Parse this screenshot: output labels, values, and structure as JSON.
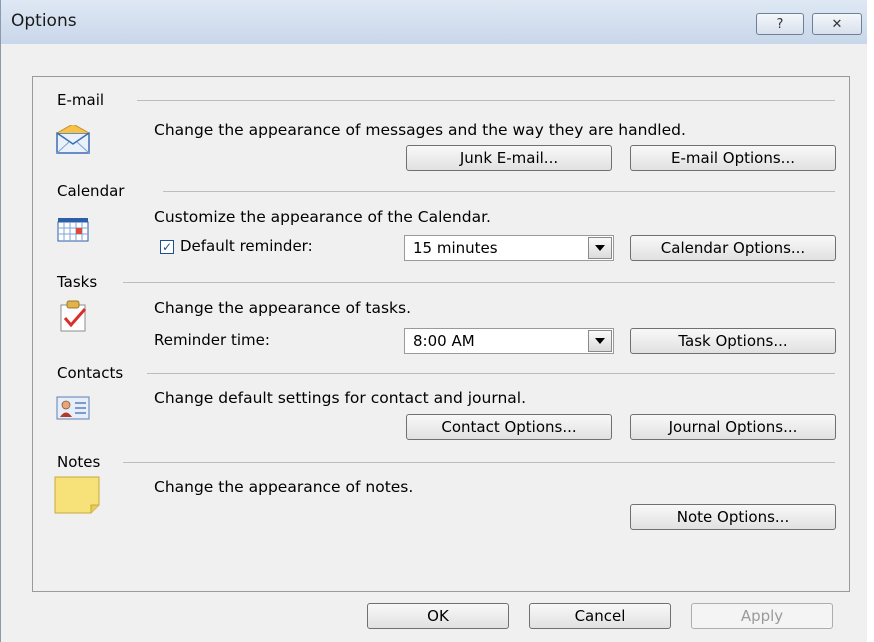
{
  "window": {
    "title": "Options",
    "help_glyph": "?",
    "close_glyph": "✕"
  },
  "email": {
    "label": "E-mail",
    "icon": "envelope-icon",
    "description": "Change the appearance of messages and the way they are handled.",
    "junk_button": "Junk E-mail...",
    "options_button": "E-mail Options..."
  },
  "calendar": {
    "label": "Calendar",
    "icon": "calendar-grid-icon",
    "description": "Customize the appearance of the Calendar.",
    "reminder_checked": true,
    "reminder_label": "Default reminder:",
    "reminder_value": "15 minutes",
    "options_button": "Calendar Options..."
  },
  "tasks": {
    "label": "Tasks",
    "icon": "task-checkmark-icon",
    "description": "Change the appearance of tasks.",
    "reminder_label": "Reminder time:",
    "reminder_value": "8:00 AM",
    "options_button": "Task Options..."
  },
  "contacts": {
    "label": "Contacts",
    "icon": "contact-card-icon",
    "description": "Change default settings for contact and journal.",
    "contact_button": "Contact Options...",
    "journal_button": "Journal Options..."
  },
  "notes": {
    "label": "Notes",
    "icon": "sticky-note-icon",
    "description": "Change the appearance of notes.",
    "options_button": "Note Options..."
  },
  "footer": {
    "ok": "OK",
    "cancel": "Cancel",
    "apply": "Apply"
  },
  "colors": {
    "accent": "#1e4f91",
    "check_red": "#d9302a",
    "note_yellow": "#f7e27a"
  }
}
